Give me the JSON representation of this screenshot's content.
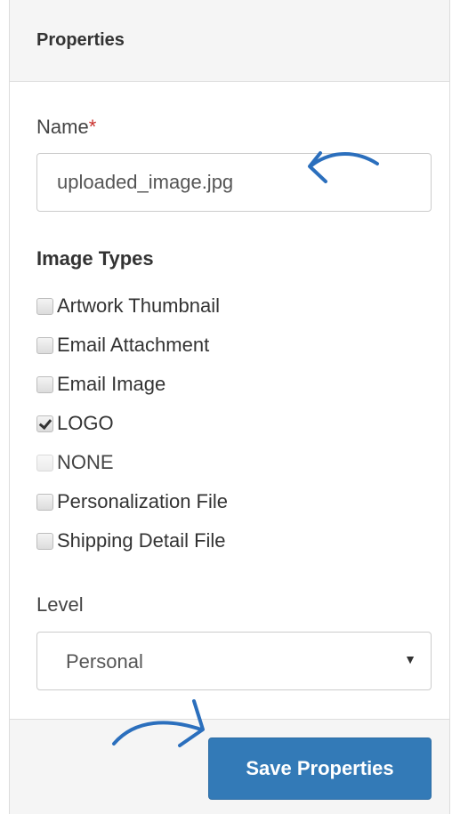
{
  "panel": {
    "title": "Properties"
  },
  "name_field": {
    "label": "Name",
    "required_mark": "*",
    "value": "uploaded_image.jpg"
  },
  "image_types": {
    "title": "Image Types",
    "options": [
      {
        "label": "Artwork Thumbnail",
        "checked": false,
        "disabled": false
      },
      {
        "label": "Email Attachment",
        "checked": false,
        "disabled": false
      },
      {
        "label": "Email Image",
        "checked": false,
        "disabled": false
      },
      {
        "label": "LOGO",
        "checked": true,
        "disabled": false
      },
      {
        "label": "NONE",
        "checked": false,
        "disabled": true
      },
      {
        "label": "Personalization File",
        "checked": false,
        "disabled": false
      },
      {
        "label": "Shipping Detail File",
        "checked": false,
        "disabled": false
      }
    ]
  },
  "level_field": {
    "label": "Level",
    "selected": "Personal",
    "arrow_icon": "caret-down-icon"
  },
  "footer": {
    "save_label": "Save Properties"
  },
  "annotations": {
    "color": "#2b6fbd",
    "arrow_icons": [
      "pointer-arrow-icon"
    ]
  },
  "colors": {
    "primary": "#337ab7",
    "required": "#c9302c",
    "heading_bg": "#f5f5f5"
  }
}
